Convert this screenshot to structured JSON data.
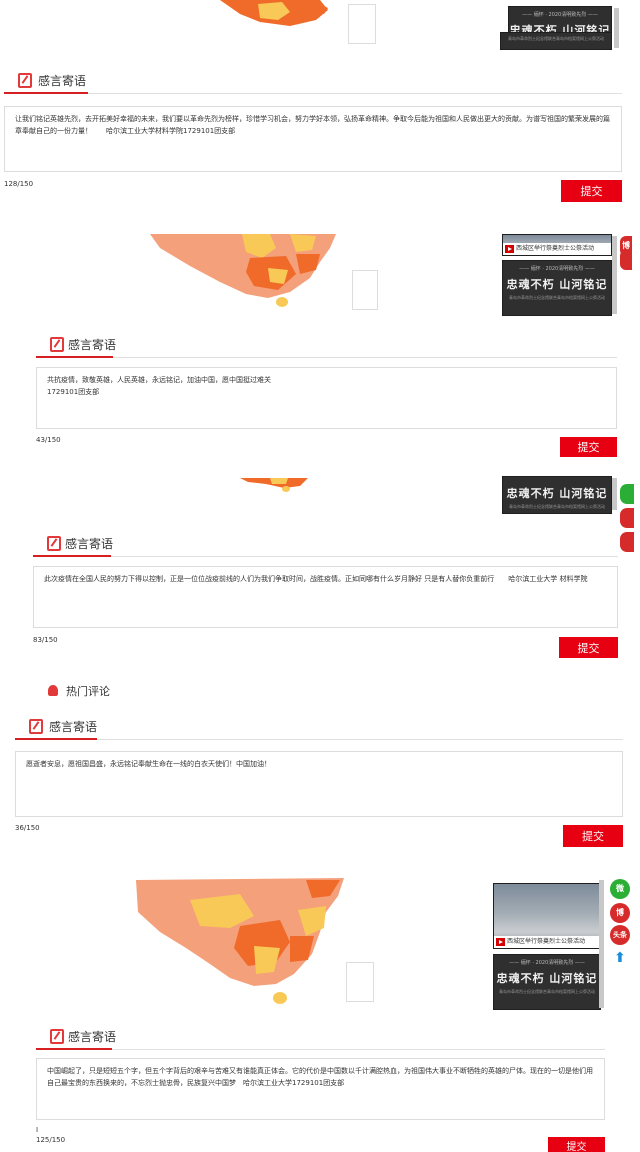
{
  "section_title": "感言寄语",
  "submit_label": "提交",
  "hot_comments_title": "热门评论",
  "thumb_banner": {
    "top": "—— 缅怀 · 2020清明致先烈 ——",
    "main": "忠魂不朽 山河铭记",
    "sub": "青岛市革命烈士纪念馆联合青岛市档案馆网上公祭活动"
  },
  "video_caption": "西城区举行祭奠烈士公祭活动",
  "share": {
    "wechat": "微",
    "weibo": "博",
    "toutiao": "头条",
    "up": "⬆"
  },
  "cards": [
    {
      "text": "让我们铭记英雄先烈，去开拓美好幸福的未来，我们要以革命先烈为榜样，珍惜学习机会，努力学好本领，弘扬革命精神。争取今后能为祖国和人民做出更大的贡献。为谱写祖国的繁荣发展的篇章奉献自己的一份力量！　　哈尔滨工业大学材料学院1729101团支部",
      "count": "128/150"
    },
    {
      "text": "共抗疫情，致敬英雄，人民英雄，永远铭记，加油中国，愿中国挺过难关\n1729101团支部",
      "count": "43/150"
    },
    {
      "text": "此次疫情在全国人民的努力下得以控制，正是一位位战疫前线的人们为我们争取时间，战胜疫情。正如同哪有什么岁月静好 只是有人替你负重前行　　哈尔滨工业大学 材料学院",
      "count": "83/150"
    },
    {
      "text": "愿逝者安息，愿祖国昌盛，永远铭记奉献生命在一线的白衣天使们！中国加油！",
      "count": "36/150"
    },
    {
      "text": "中国崛起了，只是短短五个字，但五个字背后的艰辛与苦难又有谁能真正体会。它的代价是中国数以千计满腔热血，为祖国伟大事业不断牺牲的英雄的尸体。现在的一切是他们用自己最宝贵的东西换来的，不忘烈士抛忠骨，民族复兴中国梦　哈尔滨工业大学1729101团支部",
      "count": "125/150",
      "stray": "I"
    }
  ]
}
